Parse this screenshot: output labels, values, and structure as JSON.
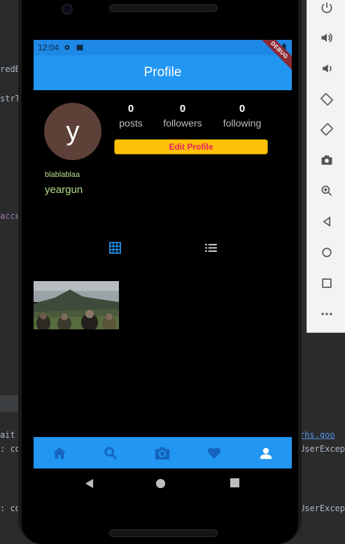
{
  "ide": {
    "lines_left": [
      "redB",
      "strT",
      "acce"
    ],
    "lines_right": [
      "rhs.goo",
      "UserExcep",
      "UserExcep"
    ],
    "lines_bottom_left": [
      "ait",
      ": co",
      ": co"
    ]
  },
  "status_bar": {
    "time": "12:04"
  },
  "app_bar": {
    "title": "Profile",
    "debug_banner": "DEBUG"
  },
  "profile": {
    "avatar_letter": "y",
    "stats": [
      {
        "value": "0",
        "label": "posts"
      },
      {
        "value": "0",
        "label": "followers"
      },
      {
        "value": "0",
        "label": "following"
      }
    ],
    "edit_button": "Edit Profile",
    "bio": "blablablaa",
    "username": "yeargun"
  },
  "tabs": {
    "grid_icon": "grid-icon",
    "list_icon": "list-icon",
    "active": "grid"
  },
  "bottom_nav": {
    "items": [
      {
        "icon": "home-icon"
      },
      {
        "icon": "search-icon"
      },
      {
        "icon": "camera-icon"
      },
      {
        "icon": "heart-icon"
      },
      {
        "icon": "person-icon",
        "active": true
      }
    ]
  },
  "emulator_controls": [
    "power-icon",
    "volume-up-icon",
    "volume-down-icon",
    "rotate-left-icon",
    "rotate-right-icon",
    "screenshot-icon",
    "zoom-icon",
    "back-icon",
    "home-icon",
    "overview-icon",
    "more-icon"
  ],
  "colors": {
    "primary": "#2196f3",
    "accent": "#ffc107",
    "edit_text": "#e91e63",
    "bio_text": "#b5e08c",
    "avatar_bg": "#5d4037"
  }
}
